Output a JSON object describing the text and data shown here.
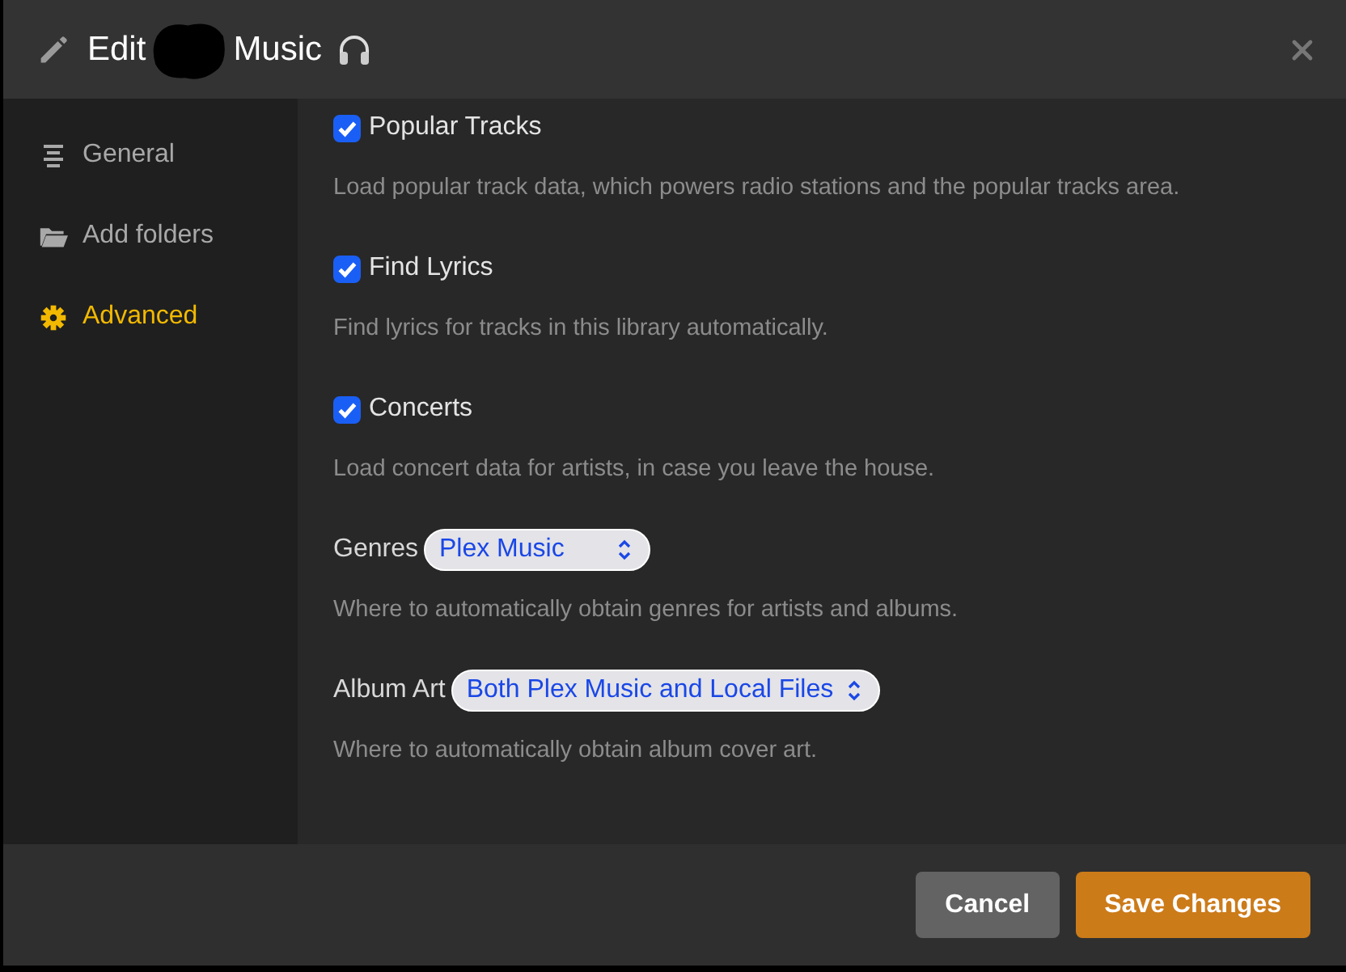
{
  "window": {
    "title_prefix": "Edit",
    "title_suffix": "Music"
  },
  "sidebar": {
    "items": [
      {
        "label": "General",
        "kind": "list",
        "selected": false
      },
      {
        "label": "Add folders",
        "kind": "folder",
        "selected": false
      },
      {
        "label": "Advanced",
        "kind": "gear",
        "selected": true
      }
    ]
  },
  "settings": [
    {
      "kind": "checkbox",
      "label": "Popular Tracks",
      "checked": true,
      "description": "Load popular track data, which powers radio stations and the popular tracks area."
    },
    {
      "kind": "checkbox",
      "label": "Find Lyrics",
      "checked": true,
      "description": "Find lyrics for tracks in this library automatically."
    },
    {
      "kind": "checkbox",
      "label": "Concerts",
      "checked": true,
      "description": "Load concert data for artists, in case you leave the house."
    },
    {
      "kind": "select",
      "label": "Genres",
      "value": "Plex Music",
      "description": "Where to automatically obtain genres for artists and albums."
    },
    {
      "kind": "select",
      "label": "Album Art",
      "value": "Both Plex Music and Local Files",
      "description": "Where to automatically obtain album cover art."
    }
  ],
  "buttons": [
    {
      "label": "Cancel",
      "kind": "secondary"
    },
    {
      "label": "Save Changes",
      "kind": "primary"
    }
  ]
}
